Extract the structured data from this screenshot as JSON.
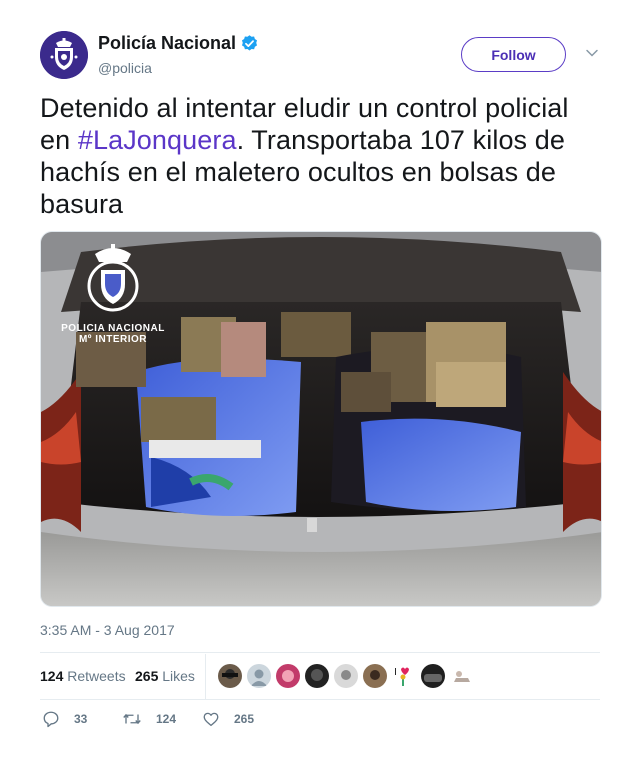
{
  "account": {
    "display_name": "Policía Nacional",
    "handle": "@policia",
    "follow_label": "Follow"
  },
  "tweet": {
    "text_before": "Detenido al intentar eludir un control policial en ",
    "hashtag": "#LaJonquera",
    "text_after": ". Transportaba 107 kilos de hachís en el maletero ocultos en bolsas de basura",
    "timestamp": "3:35 AM - 3 Aug 2017"
  },
  "media": {
    "watermark_line1": "POLICIA NACIONAL",
    "watermark_line2": "Mº INTERIOR"
  },
  "stats": {
    "retweets_count": "124",
    "retweets_label": "Retweets",
    "likes_count": "265",
    "likes_label": "Likes"
  },
  "actions": {
    "reply_count": "33",
    "retweet_count": "124",
    "like_count": "265"
  },
  "colors": {
    "accent": "#5b36c8",
    "verified": "#1da1f2",
    "muted": "#657786"
  }
}
